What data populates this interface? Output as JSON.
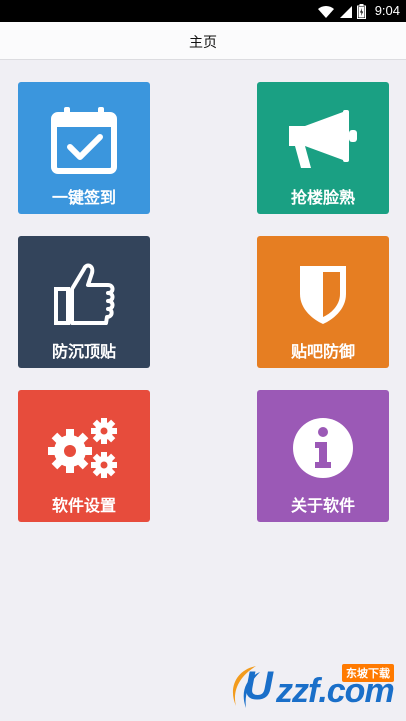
{
  "status_bar": {
    "time": "9:04"
  },
  "app_bar": {
    "title": "主页"
  },
  "tiles": [
    {
      "label": "一键签到",
      "icon": "calendar-check-icon",
      "color": "#3b96dd"
    },
    {
      "label": "抢楼脸熟",
      "icon": "megaphone-icon",
      "color": "#1aa083"
    },
    {
      "label": "防沉顶贴",
      "icon": "thumbs-up-icon",
      "color": "#33445b"
    },
    {
      "label": "贴吧防御",
      "icon": "shield-icon",
      "color": "#e67e22"
    },
    {
      "label": "软件设置",
      "icon": "gears-icon",
      "color": "#e74c3c"
    },
    {
      "label": "关于软件",
      "icon": "info-icon",
      "color": "#9b59b6"
    }
  ],
  "watermark": {
    "text": "zzf.com",
    "badge": "东坡下载"
  }
}
